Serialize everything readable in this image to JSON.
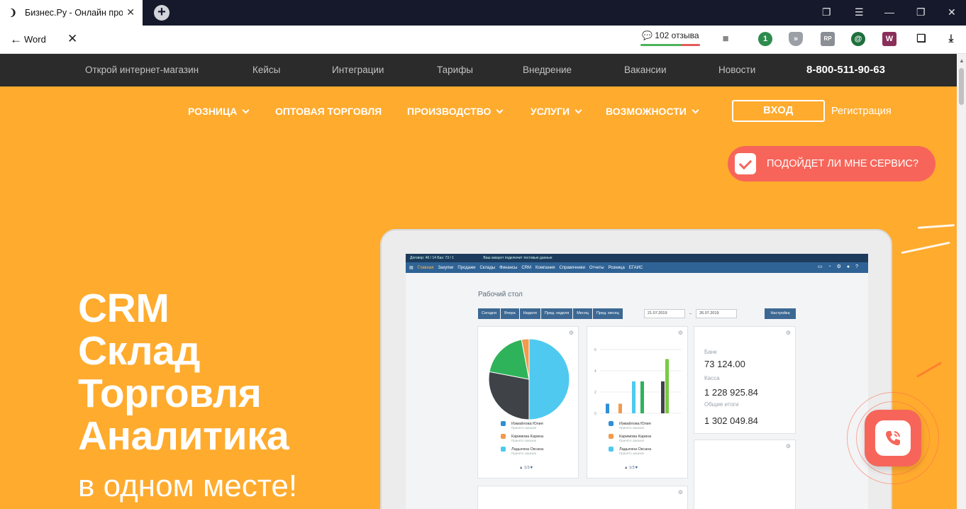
{
  "browser": {
    "tab_title": "Бизнес.Ру - Онлайн программа",
    "back_label": "Word",
    "reviews_label": "102 отзыва",
    "extensions": [
      "shield-1",
      "pocket",
      "rp",
      "spiral",
      "W",
      "book"
    ]
  },
  "topnav": {
    "items": [
      "Открой интернет-магазин",
      "Кейсы",
      "Интеграции",
      "Тарифы",
      "Внедрение",
      "Вакансии",
      "Новости"
    ],
    "phone": "8-800-511-90-63"
  },
  "mainnav": {
    "items": [
      "РОЗНИЦА",
      "ОПТОВАЯ ТОРГОВЛЯ",
      "ПРОИЗВОДСТВО",
      "УСЛУГИ",
      "ВОЗМОЖНОСТИ"
    ],
    "login": "ВХОД",
    "register": "Регистрация"
  },
  "quiz": {
    "label": "ПОДОЙДЕТ ЛИ МНЕ СЕРВИС?"
  },
  "hero": {
    "lines": [
      "CRM",
      "Склад",
      "Торговля",
      "Аналитика"
    ],
    "sub": "в одном месте!"
  },
  "app": {
    "top_left": "Договор: 46 / 14 Баз: 73 / 1",
    "top_mid": "Ваш аккаунт подключит тестовые данные",
    "menu": [
      "Главная",
      "Закупки",
      "Продажи",
      "Склады",
      "Финансы",
      "CRM",
      "Компания",
      "Справочники",
      "Отчеты",
      "Розница",
      "ЕГАИС"
    ],
    "desk_title": "Рабочий стол",
    "filters": [
      "Сегодня",
      "Вчера",
      "Неделя",
      "Пред. неделя",
      "Месяц",
      "Пред. месяц"
    ],
    "date_from": "21.07.2019",
    "date_to": "26.07.2019",
    "date_sep": "–",
    "settings": "Настройка",
    "legend": [
      {
        "name": "Измайлова Юлия",
        "sub": "Принято заказов",
        "color": "#2f8fd6"
      },
      {
        "name": "Каримова Карина",
        "sub": "Принято заказов",
        "color": "#f39a4c"
      },
      {
        "name": "Ладыгина Оксана",
        "sub": "Принято заказов",
        "color": "#4fc9f0"
      }
    ],
    "pager": "1/3",
    "pie": [
      {
        "value": 50,
        "color": "#4fc9f0"
      },
      {
        "value": 28,
        "color": "#3f4348"
      },
      {
        "value": 19,
        "color": "#2fb35a"
      },
      {
        "value": 3,
        "color": "#f39a4c"
      }
    ],
    "bars_ticks": [
      "6",
      "4",
      "2",
      "0"
    ],
    "bars": [
      {
        "value": 0.9,
        "color": "#2f8fd6"
      },
      {
        "value": 0.9,
        "color": "#f39a4c"
      },
      {
        "value": 3.0,
        "color": "#4fc9f0"
      },
      {
        "value": 3.0,
        "color": "#2fb35a"
      },
      {
        "value": 3.0,
        "color": "#3f4348"
      },
      {
        "value": 5.1,
        "color": "#7ac943"
      }
    ],
    "finance": [
      {
        "label": "Банк",
        "value": "73 124.00"
      },
      {
        "label": "Касса",
        "value": "1 228 925.84"
      },
      {
        "label": "Общие итоги",
        "value": "1 302 049.84"
      }
    ]
  },
  "colors": {
    "page_bg": "#ffab2e",
    "accent_coral": "#f7655a",
    "topnav_bg": "#2b2b2b",
    "tab_bg": "#15192b"
  }
}
